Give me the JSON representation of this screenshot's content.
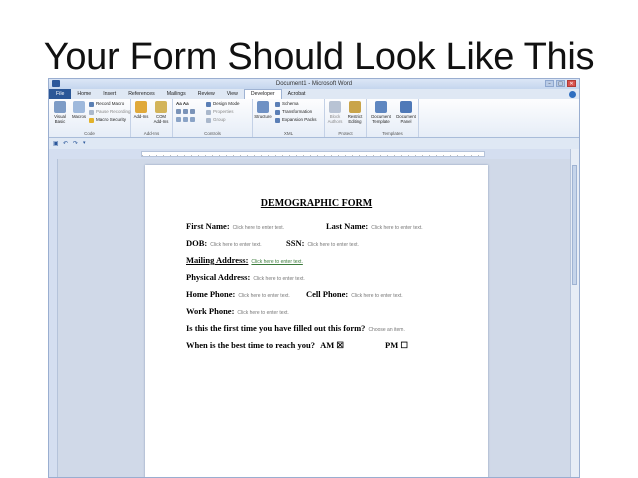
{
  "slide": {
    "title": "Your Form Should Look Like This"
  },
  "window": {
    "title": "Document1 - Microsoft Word",
    "controls": [
      "–",
      "□",
      "✕"
    ]
  },
  "tabs": [
    "File",
    "Home",
    "Insert",
    "References",
    "Mailings",
    "Review",
    "View",
    "Developer",
    "Acrobat"
  ],
  "ribbon": {
    "code": {
      "label": "Code",
      "visual_basic": "Visual Basic",
      "macros": "Macros",
      "record_macro": "Record Macro",
      "pause_recording": "Pause Recording",
      "macro_security": "Macro Security"
    },
    "addins": {
      "label": "Add-Ins",
      "addins": "Add-Ins",
      "com_addins": "COM Add-Ins"
    },
    "controls": {
      "label": "Controls",
      "font_aa": "Aa Aa",
      "design_mode": "Design Mode",
      "properties": "Properties",
      "group": "Group"
    },
    "xml": {
      "label": "XML",
      "structure": "Structure",
      "schema": "Schema",
      "transformation": "Transformation",
      "expansion_packs": "Expansion Packs"
    },
    "protect": {
      "label": "Protect",
      "block_authors": "Block Authors",
      "restrict_editing": "Restrict Editing"
    },
    "templates": {
      "label": "Templates",
      "document_template": "Document Template",
      "document_panel": "Document Panel"
    }
  },
  "form": {
    "title": "DEMOGRAPHIC FORM",
    "first_name": "First Name:",
    "last_name": "Last Name:",
    "dob": "DOB:",
    "ssn": "SSN:",
    "mailing_address": "Mailing Address:",
    "physical_address": "Physical Address:",
    "home_phone": "Home Phone:",
    "cell_phone": "Cell Phone:",
    "work_phone": "Work Phone:",
    "first_time_question": "Is this the first time you have filled out this form?",
    "best_time_question": "When is the best time to reach you?",
    "am": "AM ☒",
    "pm": "PM ☐",
    "placeholder": "Click here to enter text.",
    "choose_item": "Choose an item."
  },
  "colors": {
    "file_tab": "#2b5797",
    "ribbon_bg": "#e6edf7",
    "doc_bg": "#d0d9e8"
  }
}
